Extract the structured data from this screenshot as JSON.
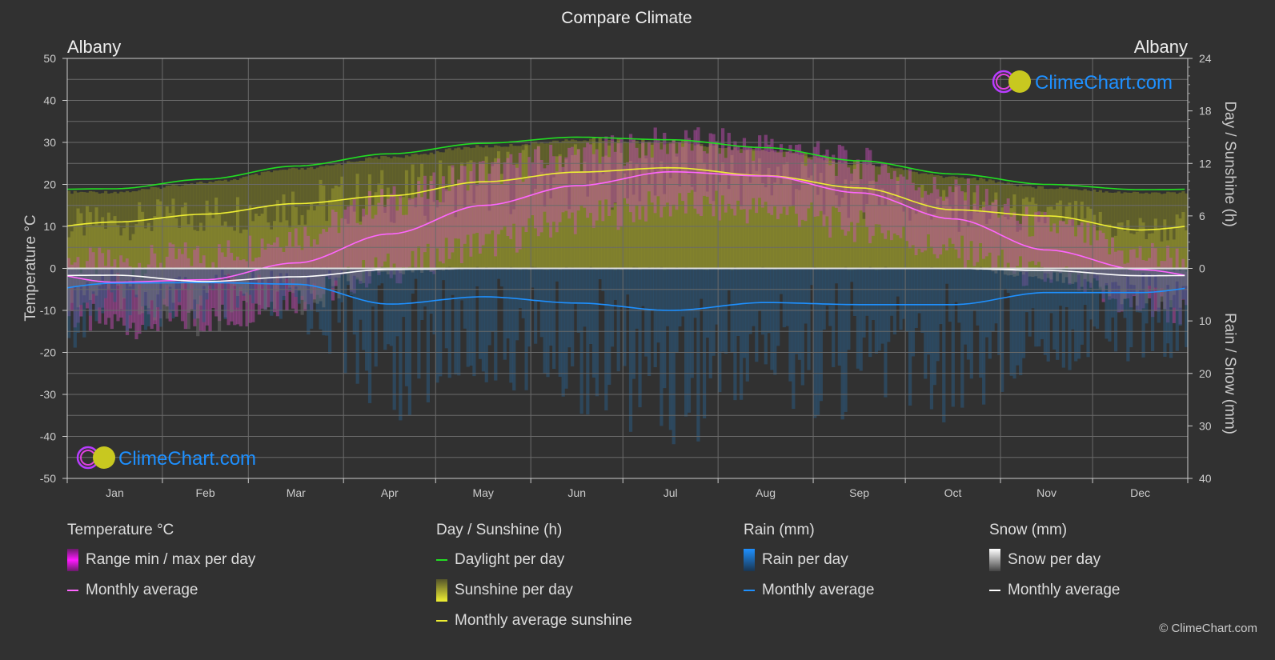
{
  "chart_data": {
    "type": "line",
    "title": "Compare Climate",
    "location_left": "Albany",
    "location_right": "Albany",
    "watermark": "ClimeChart.com",
    "copyright": "© ClimeChart.com",
    "categories": [
      "Jan",
      "Feb",
      "Mar",
      "Apr",
      "May",
      "Jun",
      "Jul",
      "Aug",
      "Sep",
      "Oct",
      "Nov",
      "Dec"
    ],
    "axes": {
      "left": {
        "label": "Temperature °C",
        "range": [
          -50,
          50
        ],
        "ticks": [
          "50",
          "40",
          "30",
          "20",
          "10",
          "0",
          "-10",
          "-20",
          "-30",
          "-40",
          "-50"
        ]
      },
      "right_top": {
        "label": "Day / Sunshine (h)",
        "range": [
          0,
          24
        ],
        "ticks": [
          "24",
          "18",
          "12",
          "6",
          "0"
        ]
      },
      "right_bottom": {
        "label": "Rain / Snow (mm)",
        "range": [
          0,
          40
        ],
        "ticks": [
          "0",
          "10",
          "20",
          "30",
          "40"
        ]
      }
    },
    "grid": true,
    "series": [
      {
        "name": "Temperature monthly average",
        "axis": "left",
        "color": "#ff66ff",
        "values": [
          -3.3,
          -2.7,
          1.3,
          8.2,
          15.0,
          19.7,
          23.0,
          22.0,
          18.0,
          11.8,
          4.4,
          -0.3
        ]
      },
      {
        "name": "Daylight per day",
        "axis": "right_top",
        "color": "#22dd22",
        "values": [
          9.1,
          10.2,
          11.7,
          13.1,
          14.3,
          15.0,
          14.7,
          13.8,
          12.3,
          10.8,
          9.6,
          9.0
        ]
      },
      {
        "name": "Monthly average sunshine",
        "axis": "right_top",
        "color": "#eeee33",
        "values": [
          5.3,
          6.2,
          7.4,
          8.3,
          9.9,
          11.0,
          11.5,
          10.6,
          9.2,
          6.7,
          6.0,
          4.4
        ]
      },
      {
        "name": "Rain monthly average",
        "axis": "right_bottom",
        "color": "#1e90ff",
        "values": [
          2.8,
          2.7,
          3.0,
          6.8,
          5.4,
          6.6,
          8.0,
          6.5,
          6.9,
          6.9,
          4.6,
          4.6
        ]
      },
      {
        "name": "Snow monthly average",
        "axis": "right_bottom",
        "color": "#ffffff",
        "values": [
          1.3,
          2.5,
          1.6,
          0.2,
          0.0,
          0.0,
          0.0,
          0.0,
          0.0,
          0.0,
          0.4,
          1.4
        ]
      }
    ],
    "temp_range_approx": {
      "max": [
        1,
        3,
        8,
        16,
        23,
        27,
        30,
        29,
        25,
        18,
        10,
        3
      ],
      "min": [
        -13,
        -12,
        -7,
        0,
        6,
        12,
        15,
        14,
        10,
        4,
        -2,
        -9
      ]
    }
  },
  "legend": {
    "groups": [
      {
        "title": "Temperature °C",
        "items": [
          {
            "label": "Range min / max per day",
            "type": "bar",
            "color": "#e619e6"
          },
          {
            "label": "Monthly average",
            "type": "line",
            "color": "#ff66ff"
          }
        ]
      },
      {
        "title": "Day / Sunshine (h)",
        "items": [
          {
            "label": "Daylight per day",
            "type": "line",
            "color": "#22dd22"
          },
          {
            "label": "Sunshine per day",
            "type": "bar",
            "color": "#e6e633"
          },
          {
            "label": "Monthly average sunshine",
            "type": "line",
            "color": "#eeee33"
          }
        ]
      },
      {
        "title": "Rain (mm)",
        "items": [
          {
            "label": "Rain per day",
            "type": "bar",
            "color": "#1e90ff"
          },
          {
            "label": "Monthly average",
            "type": "line",
            "color": "#1e90ff"
          }
        ]
      },
      {
        "title": "Snow (mm)",
        "items": [
          {
            "label": "Snow per day",
            "type": "bar",
            "color": "#dddddd"
          },
          {
            "label": "Monthly average",
            "type": "line",
            "color": "#ffffff"
          }
        ]
      }
    ]
  }
}
